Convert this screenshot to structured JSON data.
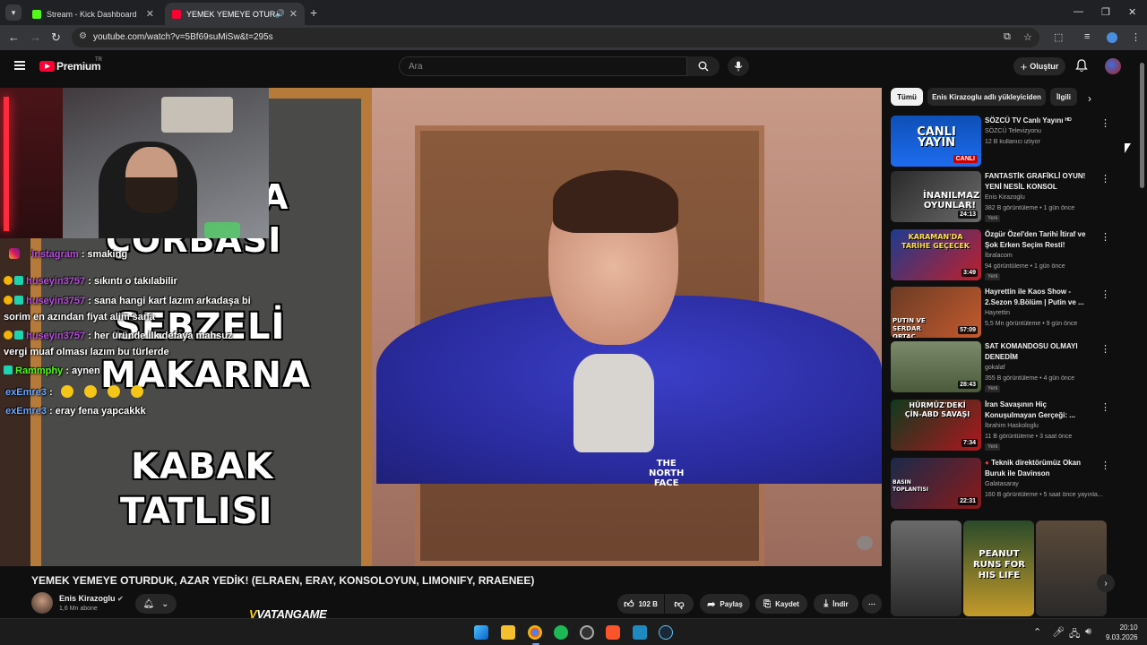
{
  "browser": {
    "tabs": [
      {
        "title": "Stream - Kick Dashboard",
        "active": false
      },
      {
        "title": "YEMEK YEMEYE OTURDUK,",
        "active": true
      }
    ],
    "url": "youtube.com/watch?v=5Bf69suMiSw&t=295s"
  },
  "youtube": {
    "logo_text": "Premium",
    "region": "TR",
    "search_placeholder": "Ara",
    "create_label": "Oluştur"
  },
  "video": {
    "board_lines": [
      "A",
      "ÇORBASI",
      "SEBZELİ",
      "MAKARNA",
      "KABAK",
      "TATLISI"
    ],
    "title": "YEMEK YEMEYE OTURDUK, AZAR YEDİK! (ELRAEN, ERAY, KONSOLOYUN, LIMONIFY, RRAENEE)",
    "channel": "Enis Kirazoglu",
    "subscribers": "1,6 Mn abone",
    "likes": "102 B",
    "share_label": "Paylaş",
    "save_label": "Kaydet",
    "download_label": "İndir",
    "watermark": "VATANGAME"
  },
  "chat": [
    {
      "user": "instagram",
      "text": ": smaking"
    },
    {
      "user": "huseyin3757",
      "text": ": sıkıntı o takılabilir"
    },
    {
      "user": "huseyin3757",
      "text": ": sana hangi kart lazım arkadaşa bi"
    },
    {
      "user": "",
      "text": "sorim en azından fiyat alim sana"
    },
    {
      "user": "huseyin3757",
      "text": ": her üründe ilk defaya mahsuz"
    },
    {
      "user": "",
      "text": "vergi muaf olması lazım bu türlerde"
    },
    {
      "user": "Rammphy",
      "text": ": aynen"
    },
    {
      "user": "exEmre3",
      "text": ":"
    },
    {
      "user": "exEmre3",
      "text": ": eray fena yapcakkk"
    }
  ],
  "chips": [
    "Tümü",
    "Enis Kirazoglu adlı yükleyiciden",
    "İlgili"
  ],
  "recommendations": [
    {
      "title": "SÖZCÜ TV Canlı Yayını ᴴᴰ",
      "channel": "SÖZCÜ Televizyonu",
      "meta": "12 B kullanıcı izliyor",
      "duration": "",
      "live": "CANLI",
      "thumb_text": "CANLI YAYIN",
      "new": ""
    },
    {
      "title": "FANTASTİK GRAFİKLİ OYUN! YENİ NESİL KONSOL GELİYOR!...",
      "channel": "Enis Kirazoglu",
      "meta": "382 B görüntüleme • 1 gün önce",
      "duration": "24:13",
      "live": "",
      "thumb_text": "İNANILMAZ OYUNLAR!",
      "new": "Yeni"
    },
    {
      "title": "Özgür Özel'den Tarihi İtiraf ve Şok Erken Seçim Resti!",
      "channel": "İbralacom",
      "meta": "94 görüntüleme • 1 gün önce",
      "duration": "3:49",
      "live": "",
      "thumb_text": "KARAMAN'DA TARİHE GEÇECEK",
      "new": "Yeni"
    },
    {
      "title": "Hayrettin ile Kaos Show - 2.Sezon 9.Bölüm | Putin ve ...",
      "channel": "Hayrettin",
      "meta": "5,5 Mn görüntüleme • 9 gün önce",
      "duration": "57:09",
      "live": "",
      "thumb_text": "PUTIN VE SERDAR ORTAÇ",
      "new": ""
    },
    {
      "title": "SAT KOMANDOSU OLMAYI DENEDİM",
      "channel": "gokalaf",
      "meta": "355 B görüntüleme • 4 gün önce",
      "duration": "28:43",
      "live": "",
      "thumb_text": "",
      "new": "Yeni"
    },
    {
      "title": "İran Savaşının Hiç Konuşulmayan Gerçeği: ...",
      "channel": "İbrahim Haskologlu",
      "meta": "11 B görüntüleme • 3 saat önce",
      "duration": "7:34",
      "live": "",
      "thumb_text": "HÜRMÜZ'DEKİ ÇİN-ABD SAVAŞI",
      "new": "Yeni"
    },
    {
      "title": "Teknik direktörümüz Okan Buruk ile Davinson Sánchez'in,...",
      "channel": "Galatasaray",
      "meta": "160 B görüntüleme • 5 saat önce yayınla...",
      "duration": "22:31",
      "live": "",
      "thumb_text": "BASIN TOPLANTISI",
      "new": ""
    }
  ],
  "shorts": [
    {
      "text": ""
    },
    {
      "text": "PEANUT RUNS FOR HIS LIFE"
    },
    {
      "text": ""
    }
  ],
  "taskbar": {
    "time": "20:10",
    "date": "9.03.2026"
  },
  "colors": {
    "yt_red": "#ff0033",
    "kick_green": "#53fc18",
    "background": "#0f0f0f"
  }
}
